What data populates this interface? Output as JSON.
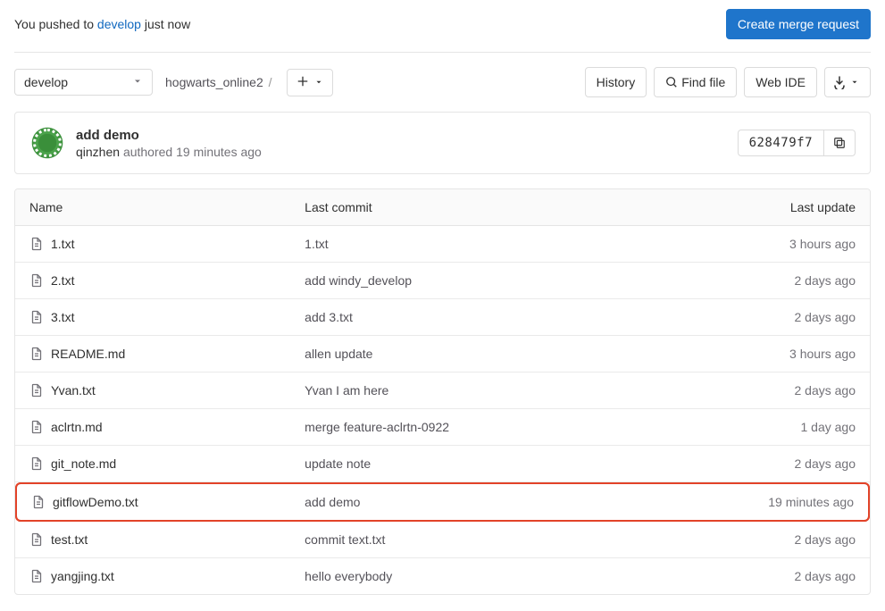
{
  "push_notice": {
    "prefix": "You pushed to ",
    "branch": "develop",
    "suffix": " just now"
  },
  "buttons": {
    "create_mr": "Create merge request",
    "history": "History",
    "find_file": "Find file",
    "web_ide": "Web IDE"
  },
  "branch_selector": "develop",
  "breadcrumb": {
    "repo": "hogwarts_online2",
    "sep": "/"
  },
  "commit": {
    "title": "add demo",
    "author": "qinzhen",
    "authored": "authored",
    "time": "19 minutes ago",
    "sha": "628479f7"
  },
  "table": {
    "headers": {
      "name": "Name",
      "last_commit": "Last commit",
      "last_update": "Last update"
    },
    "rows": [
      {
        "name": "1.txt",
        "commit": "1.txt",
        "update": "3 hours ago",
        "highlight": false
      },
      {
        "name": "2.txt",
        "commit": "add windy_develop",
        "update": "2 days ago",
        "highlight": false
      },
      {
        "name": "3.txt",
        "commit": "add 3.txt",
        "update": "2 days ago",
        "highlight": false
      },
      {
        "name": "README.md",
        "commit": "allen update",
        "update": "3 hours ago",
        "highlight": false
      },
      {
        "name": "Yvan.txt",
        "commit": "Yvan I am here",
        "update": "2 days ago",
        "highlight": false
      },
      {
        "name": "aclrtn.md",
        "commit": "merge feature-aclrtn-0922",
        "update": "1 day ago",
        "highlight": false
      },
      {
        "name": "git_note.md",
        "commit": "update note",
        "update": "2 days ago",
        "highlight": false
      },
      {
        "name": "gitflowDemo.txt",
        "commit": "add demo",
        "update": "19 minutes ago",
        "highlight": true
      },
      {
        "name": "test.txt",
        "commit": "commit text.txt",
        "update": "2 days ago",
        "highlight": false
      },
      {
        "name": "yangjing.txt",
        "commit": "hello everybody",
        "update": "2 days ago",
        "highlight": false
      }
    ]
  }
}
